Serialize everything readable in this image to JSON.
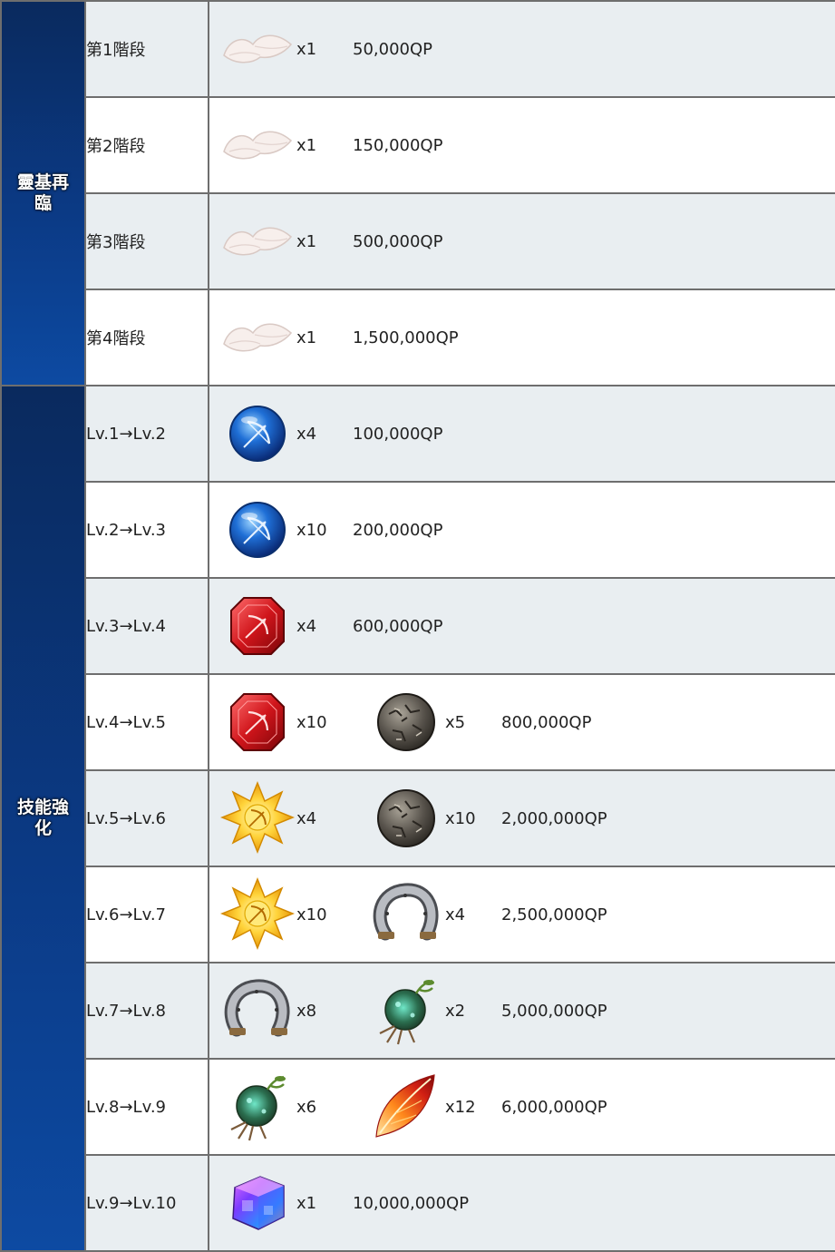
{
  "ascension": {
    "header": "靈基再臨",
    "rows": [
      {
        "label": "第1階段",
        "items": [
          {
            "icon": "white-feather-icon",
            "qty": "x1"
          }
        ],
        "qp": "50,000QP"
      },
      {
        "label": "第2階段",
        "items": [
          {
            "icon": "white-feather-icon",
            "qty": "x1"
          }
        ],
        "qp": "150,000QP"
      },
      {
        "label": "第3階段",
        "items": [
          {
            "icon": "white-feather-icon",
            "qty": "x1"
          }
        ],
        "qp": "500,000QP"
      },
      {
        "label": "第4階段",
        "items": [
          {
            "icon": "white-feather-icon",
            "qty": "x1"
          }
        ],
        "qp": "1,500,000QP"
      }
    ]
  },
  "skill": {
    "header": "技能強化",
    "rows": [
      {
        "label": "Lv.1→Lv.2",
        "items": [
          {
            "icon": "archer-gem-icon",
            "qty": "x4"
          }
        ],
        "qp": "100,000QP"
      },
      {
        "label": "Lv.2→Lv.3",
        "items": [
          {
            "icon": "archer-gem-icon",
            "qty": "x10"
          }
        ],
        "qp": "200,000QP"
      },
      {
        "label": "Lv.3→Lv.4",
        "items": [
          {
            "icon": "archer-magic-gem-icon",
            "qty": "x4"
          }
        ],
        "qp": "600,000QP"
      },
      {
        "label": "Lv.4→Lv.5",
        "items": [
          {
            "icon": "archer-magic-gem-icon",
            "qty": "x10"
          },
          {
            "icon": "seed-stone-icon",
            "qty": "x5"
          }
        ],
        "qp": "800,000QP"
      },
      {
        "label": "Lv.5→Lv.6",
        "items": [
          {
            "icon": "archer-secret-gem-icon",
            "qty": "x4"
          },
          {
            "icon": "seed-stone-icon",
            "qty": "x10"
          }
        ],
        "qp": "2,000,000QP"
      },
      {
        "label": "Lv.6→Lv.7",
        "items": [
          {
            "icon": "archer-secret-gem-icon",
            "qty": "x10"
          },
          {
            "icon": "horseshoe-icon",
            "qty": "x4"
          }
        ],
        "qp": "2,500,000QP"
      },
      {
        "label": "Lv.7→Lv.8",
        "items": [
          {
            "icon": "horseshoe-icon",
            "qty": "x8"
          },
          {
            "icon": "root-bulb-icon",
            "qty": "x2"
          }
        ],
        "qp": "5,000,000QP"
      },
      {
        "label": "Lv.8→Lv.9",
        "items": [
          {
            "icon": "root-bulb-icon",
            "qty": "x6"
          },
          {
            "icon": "phoenix-feather-icon",
            "qty": "x12"
          }
        ],
        "qp": "6,000,000QP"
      },
      {
        "label": "Lv.9→Lv.10",
        "items": [
          {
            "icon": "crystal-cube-icon",
            "qty": "x1"
          }
        ],
        "qp": "10,000,000QP"
      }
    ]
  }
}
